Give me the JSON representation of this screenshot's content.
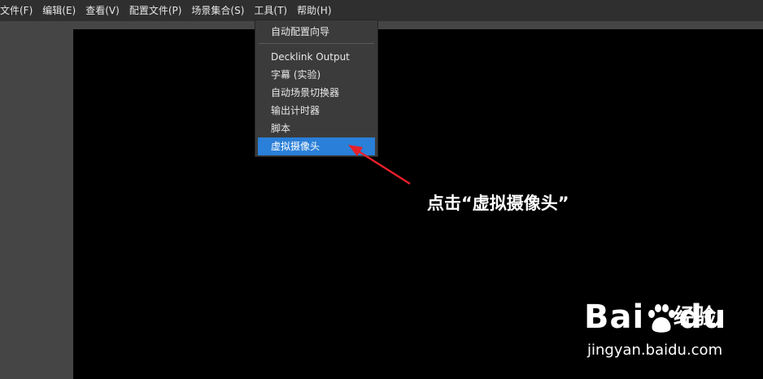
{
  "menubar": {
    "items": [
      {
        "label": "文件(F)"
      },
      {
        "label": "编辑(E)"
      },
      {
        "label": "查看(V)"
      },
      {
        "label": "配置文件(P)"
      },
      {
        "label": "场景集合(S)"
      },
      {
        "label": "工具(T)"
      },
      {
        "label": "帮助(H)"
      }
    ]
  },
  "tools_menu": {
    "items": [
      {
        "label": "自动配置向导"
      },
      {
        "label": "Decklink Output"
      },
      {
        "label": "字幕 (实验)"
      },
      {
        "label": "自动场景切换器"
      },
      {
        "label": "输出计时器"
      },
      {
        "label": "脚本"
      },
      {
        "label": "虚拟摄像头",
        "highlighted": true
      }
    ]
  },
  "annotation": {
    "text": "点击“虚拟摄像头”",
    "arrow_color": "#e8202a"
  },
  "watermark": {
    "logo_text": "Bai",
    "logo_text_2": "du",
    "cn_text": "经验",
    "url": "jingyan.baidu.com"
  },
  "colors": {
    "menubar_bg": "#2f2f2f",
    "preview_bg": "#000000",
    "highlight": "#2a7fd8"
  }
}
